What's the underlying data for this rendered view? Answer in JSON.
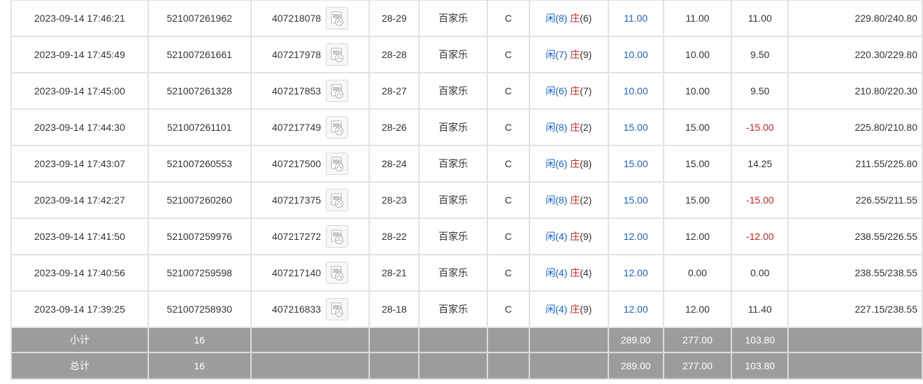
{
  "rows": [
    {
      "time": "2023-09-14 17:46:21",
      "order_no": "521007261962",
      "round_no": "407218078",
      "shoe": "28-29",
      "game": "百家乐",
      "table": "C",
      "player_label": "闲",
      "player_value": "(8)",
      "banker_label": "庄",
      "banker_value": "(6)",
      "bet": "11.00",
      "valid_bet": "11.00",
      "win_loss": "11.00",
      "balance": "229.80/240.80"
    },
    {
      "time": "2023-09-14 17:45:49",
      "order_no": "521007261661",
      "round_no": "407217978",
      "shoe": "28-28",
      "game": "百家乐",
      "table": "C",
      "player_label": "闲",
      "player_value": "(7)",
      "banker_label": "庄",
      "banker_value": "(9)",
      "bet": "10.00",
      "valid_bet": "10.00",
      "win_loss": "9.50",
      "balance": "220.30/229.80"
    },
    {
      "time": "2023-09-14 17:45:00",
      "order_no": "521007261328",
      "round_no": "407217853",
      "shoe": "28-27",
      "game": "百家乐",
      "table": "C",
      "player_label": "闲",
      "player_value": "(6)",
      "banker_label": "庄",
      "banker_value": "(7)",
      "bet": "10.00",
      "valid_bet": "10.00",
      "win_loss": "9.50",
      "balance": "210.80/220.30"
    },
    {
      "time": "2023-09-14 17:44:30",
      "order_no": "521007261101",
      "round_no": "407217749",
      "shoe": "28-26",
      "game": "百家乐",
      "table": "C",
      "player_label": "闲",
      "player_value": "(8)",
      "banker_label": "庄",
      "banker_value": "(2)",
      "bet": "15.00",
      "valid_bet": "15.00",
      "win_loss": "-15.00",
      "balance": "225.80/210.80"
    },
    {
      "time": "2023-09-14 17:43:07",
      "order_no": "521007260553",
      "round_no": "407217500",
      "shoe": "28-24",
      "game": "百家乐",
      "table": "C",
      "player_label": "闲",
      "player_value": "(6)",
      "banker_label": "庄",
      "banker_value": "(8)",
      "bet": "15.00",
      "valid_bet": "15.00",
      "win_loss": "14.25",
      "balance": "211.55/225.80"
    },
    {
      "time": "2023-09-14 17:42:27",
      "order_no": "521007260260",
      "round_no": "407217375",
      "shoe": "28-23",
      "game": "百家乐",
      "table": "C",
      "player_label": "闲",
      "player_value": "(8)",
      "banker_label": "庄",
      "banker_value": "(2)",
      "bet": "15.00",
      "valid_bet": "15.00",
      "win_loss": "-15.00",
      "balance": "226.55/211.55"
    },
    {
      "time": "2023-09-14 17:41:50",
      "order_no": "521007259976",
      "round_no": "407217272",
      "shoe": "28-22",
      "game": "百家乐",
      "table": "C",
      "player_label": "闲",
      "player_value": "(4)",
      "banker_label": "庄",
      "banker_value": "(9)",
      "bet": "12.00",
      "valid_bet": "12.00",
      "win_loss": "-12.00",
      "balance": "238.55/226.55"
    },
    {
      "time": "2023-09-14 17:40:56",
      "order_no": "521007259598",
      "round_no": "407217140",
      "shoe": "28-21",
      "game": "百家乐",
      "table": "C",
      "player_label": "闲",
      "player_value": "(4)",
      "banker_label": "庄",
      "banker_value": "(4)",
      "bet": "12.00",
      "valid_bet": "0.00",
      "win_loss": "0.00",
      "balance": "238.55/238.55"
    },
    {
      "time": "2023-09-14 17:39:25",
      "order_no": "521007258930",
      "round_no": "407216833",
      "shoe": "28-18",
      "game": "百家乐",
      "table": "C",
      "player_label": "闲",
      "player_value": "(4)",
      "banker_label": "庄",
      "banker_value": "(9)",
      "bet": "12.00",
      "valid_bet": "12.00",
      "win_loss": "11.40",
      "balance": "227.15/238.55"
    }
  ],
  "subtotal": {
    "label": "小计",
    "count": "16",
    "bet": "289.00",
    "valid_bet": "277.00",
    "win_loss": "103.80"
  },
  "total": {
    "label": "总计",
    "count": "16",
    "bet": "289.00",
    "valid_bet": "277.00",
    "win_loss": "103.80"
  },
  "icons": {
    "replay": "video-replay-icon"
  },
  "colors": {
    "player": "#1a5fcf",
    "banker": "#d91e18",
    "bet": "#1a5fcf",
    "loss": "#d91e18",
    "summary_bg": "#9c9c9c",
    "grid": "#e2e2e2"
  }
}
